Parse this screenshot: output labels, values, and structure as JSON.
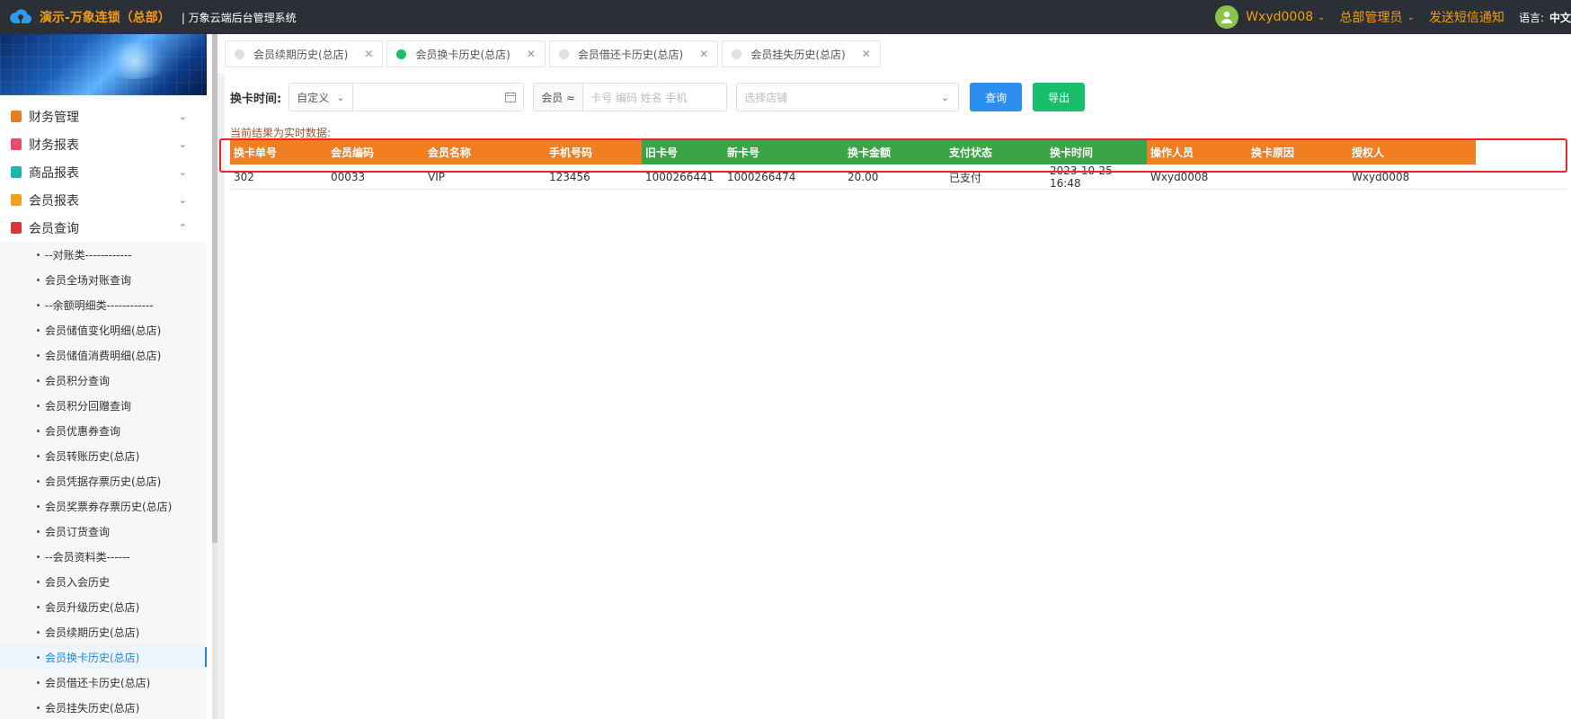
{
  "header": {
    "brand": "演示-万象连锁（总部）",
    "system_name": "| 万象云端后台管理系统",
    "user": "Wxyd0008",
    "role": "总部管理员",
    "sms": "发送短信通知",
    "lang_label": "语言:",
    "lang_value": "中文"
  },
  "sidebar": {
    "groups": [
      {
        "label": "财务管理",
        "color": "#e67e22"
      },
      {
        "label": "财务报表",
        "color": "#e84c6c"
      },
      {
        "label": "商品报表",
        "color": "#1fb5ad"
      },
      {
        "label": "会员报表",
        "color": "#f0a020"
      },
      {
        "label": "会员查询",
        "color": "#d63636"
      }
    ],
    "sub_items": [
      "--对账类------------",
      "会员全场对账查询",
      "--余额明细类------------",
      "会员储值变化明细(总店)",
      "会员储值消费明细(总店)",
      "会员积分查询",
      "会员积分回赠查询",
      "会员优惠券查询",
      "会员转账历史(总店)",
      "会员凭据存票历史(总店)",
      "会员奖票券存票历史(总店)",
      "会员订货查询",
      "--会员资料类------",
      "会员入会历史",
      "会员升级历史(总店)",
      "会员续期历史(总店)",
      "会员换卡历史(总店)",
      "会员借还卡历史(总店)",
      "会员挂失历史(总店)"
    ]
  },
  "tabs": [
    {
      "label": "会员续期历史(总店)",
      "active": false
    },
    {
      "label": "会员换卡历史(总店)",
      "active": true
    },
    {
      "label": "会员借还卡历史(总店)",
      "active": false
    },
    {
      "label": "会员挂失历史(总店)",
      "active": false
    }
  ],
  "filter": {
    "label": "换卡时间:",
    "range_type": "自定义",
    "member_prefix": "会员 ≈",
    "member_placeholder": "卡号 编码 姓名 手机",
    "store_placeholder": "选择店铺",
    "query_button": "查询",
    "export_button": "导出"
  },
  "notice": "当前结果为实时数据:",
  "table": {
    "columns": [
      "换卡单号",
      "会员编码",
      "会员名称",
      "手机号码",
      "旧卡号",
      "新卡号",
      "换卡金额",
      "支付状态",
      "换卡时间",
      "操作人员",
      "换卡原因",
      "授权人"
    ],
    "rows": [
      [
        "302",
        "00033",
        "VIP",
        "123456",
        "1000266441",
        "1000266474",
        "20.00",
        "已支付",
        "2023-10-25 16:48",
        "Wxyd0008",
        "",
        "Wxyd0008"
      ]
    ]
  }
}
